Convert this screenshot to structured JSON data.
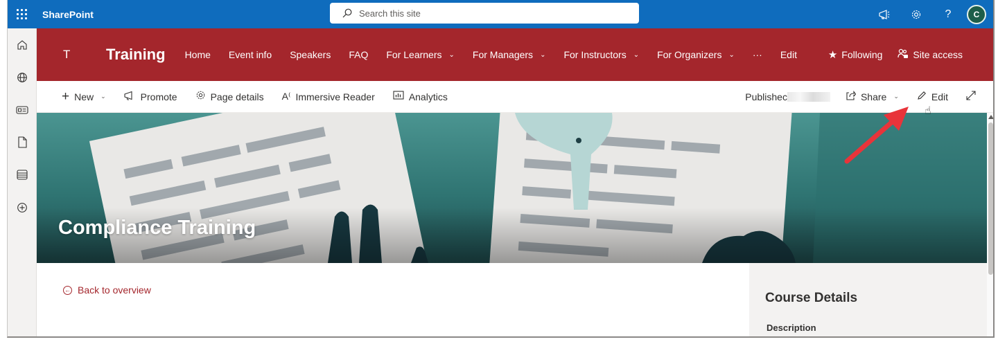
{
  "suitebar": {
    "app_name": "SharePoint",
    "search_placeholder": "Search this site",
    "icons": [
      "megaphone-icon",
      "settings-gear-icon",
      "help-question-icon"
    ],
    "avatar_initial": "C"
  },
  "rail": {
    "icons": [
      "home-icon",
      "globe-icon",
      "news-icon",
      "file-icon",
      "list-icon",
      "add-circle-icon"
    ]
  },
  "site": {
    "logo_letter": "T",
    "title": "Training",
    "nav": [
      {
        "label": "Home",
        "dropdown": false
      },
      {
        "label": "Event info",
        "dropdown": false
      },
      {
        "label": "Speakers",
        "dropdown": false
      },
      {
        "label": "FAQ",
        "dropdown": false
      },
      {
        "label": "For Learners",
        "dropdown": true
      },
      {
        "label": "For Managers",
        "dropdown": true
      },
      {
        "label": "For Instructors",
        "dropdown": true
      },
      {
        "label": "For Organizers",
        "dropdown": true
      },
      {
        "label": "···",
        "dropdown": false
      },
      {
        "label": "Edit",
        "dropdown": false
      }
    ],
    "following_label": "Following",
    "site_access_label": "Site access",
    "header_color": "#a4262c"
  },
  "commandbar": {
    "new_label": "New",
    "promote_label": "Promote",
    "page_details_label": "Page details",
    "immersive_reader_label": "Immersive Reader",
    "analytics_label": "Analytics",
    "published_label": "Publishec",
    "share_label": "Share",
    "edit_label": "Edit"
  },
  "hero": {
    "title": "Compliance Training"
  },
  "content": {
    "back_label": "Back to overview",
    "course_details_title": "Course Details",
    "description_label": "Description"
  },
  "colors": {
    "suitebar": "#0f6cbd",
    "accent": "#a4262c",
    "annotation_arrow": "#e8343a"
  }
}
